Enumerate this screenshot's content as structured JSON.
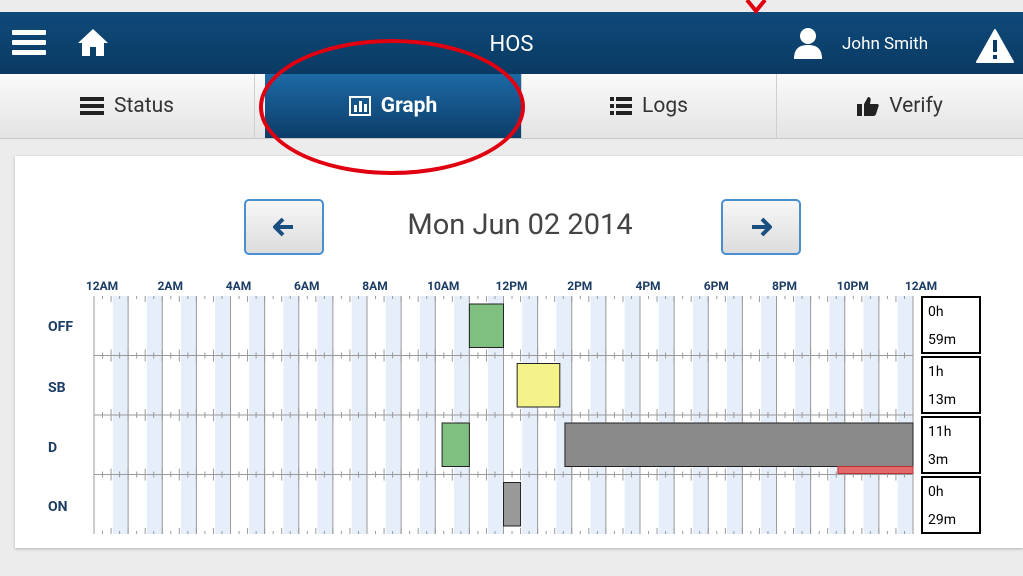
{
  "header": {
    "title": "HOS",
    "user_name": "John Smith"
  },
  "tabs": [
    {
      "label": "Status",
      "icon": "status-icon",
      "active": false
    },
    {
      "label": "Graph",
      "icon": "chart-icon",
      "active": true
    },
    {
      "label": "Logs",
      "icon": "list-icon",
      "active": false
    },
    {
      "label": "Verify",
      "icon": "thumbs-up-icon",
      "active": false
    }
  ],
  "date": "Mon Jun 02 2014",
  "time_labels": [
    "12AM",
    "2AM",
    "4AM",
    "6AM",
    "8AM",
    "10AM",
    "12PM",
    "2PM",
    "4PM",
    "6PM",
    "8PM",
    "10PM",
    "12AM"
  ],
  "rows": [
    {
      "status": "OFF",
      "total_hours": "0h",
      "total_minutes": "59m"
    },
    {
      "status": "SB",
      "total_hours": "1h",
      "total_minutes": "13m"
    },
    {
      "status": "D",
      "total_hours": "11h",
      "total_minutes": "3m"
    },
    {
      "status": "ON",
      "total_hours": "0h",
      "total_minutes": "29m"
    }
  ],
  "chart_data": {
    "type": "timeline",
    "x_range_hours": [
      0,
      24
    ],
    "rows": [
      "OFF",
      "SB",
      "D",
      "ON"
    ],
    "segments": [
      {
        "row": "OFF",
        "start": 11.0,
        "end": 12.0,
        "color": "#7fbf7f"
      },
      {
        "row": "SB",
        "start": 12.4,
        "end": 13.65,
        "color": "#f3f38a"
      },
      {
        "row": "D",
        "start": 10.2,
        "end": 11.0,
        "color": "#7fbf7f"
      },
      {
        "row": "D",
        "start": 13.8,
        "end": 24.0,
        "color": "#8a8a8a"
      },
      {
        "row": "D",
        "start": 21.8,
        "end": 24.0,
        "color": "#e36a6a",
        "style": "violation-bar"
      },
      {
        "row": "ON",
        "start": 12.0,
        "end": 12.5,
        "color": "#999999"
      }
    ]
  },
  "colors": {
    "header": "#0f4a7a",
    "active_tab": "#135489",
    "annotation": "#e10010"
  }
}
